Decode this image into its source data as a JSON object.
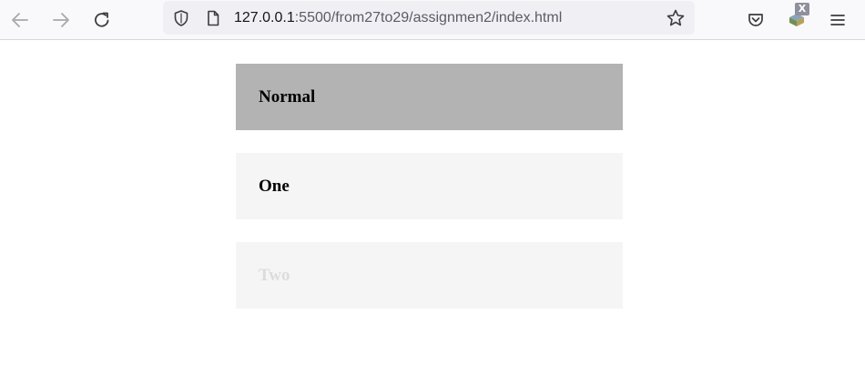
{
  "browser": {
    "url_host": "127.0.0.1",
    "url_rest": ":5500/from27to29/assignmen2/index.html",
    "extension_badge": "X",
    "icons": {
      "back": "arrow-left-icon",
      "forward": "arrow-right-icon",
      "reload": "reload-icon",
      "tracking_protection": "shield-icon",
      "page_info": "page-icon",
      "bookmark": "star-icon",
      "pocket": "pocket-icon",
      "extension": "extension-icon",
      "menu": "hamburger-menu-icon"
    }
  },
  "page": {
    "boxes": [
      {
        "label": "Normal",
        "background": "#b3b3b3",
        "text_color": "#000000"
      },
      {
        "label": "One",
        "background": "#f5f5f5",
        "text_color": "#000000"
      },
      {
        "label": "Two",
        "background": "#f5f5f5",
        "text_color": "#dcdcdc"
      }
    ]
  }
}
